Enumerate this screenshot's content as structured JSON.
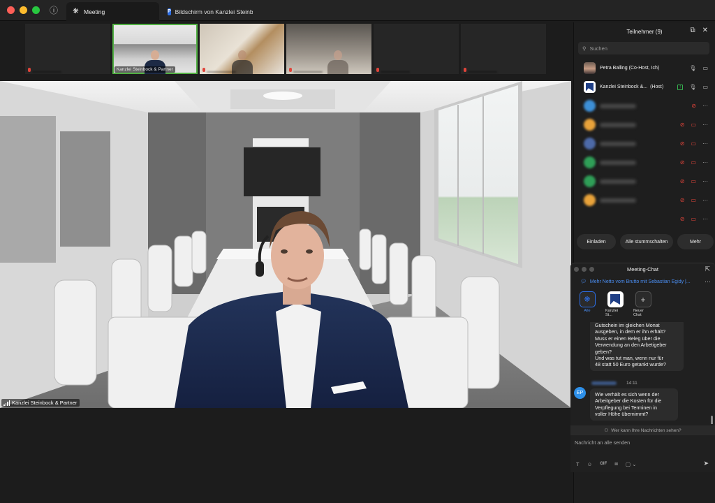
{
  "window": {
    "tab_active": "Meeting",
    "tab_share": "Bildschirm von Kanzlei Steinbock"
  },
  "gallery": {
    "selected_name": "Kanzlei Steinbock & Partner"
  },
  "speaker": {
    "name": "Kanzlei Steinbock & Partner"
  },
  "participants": {
    "title": "Teilnehmer (9)",
    "search_placeholder": "Suchen",
    "rows": [
      {
        "name": "Petra Balling (Co-Host, Ich)"
      },
      {
        "name": "Kanzlei Steinbock &...",
        "role": "(Host)"
      }
    ],
    "invite_label": "Einladen",
    "mute_all_label": "Alle stummschalten",
    "more_label": "Mehr"
  },
  "chat": {
    "title": "Meeting-Chat",
    "topic": "Mehr Netto vom Brutto mit Sebastian Egidy |...",
    "recipients": [
      {
        "label": "Alle"
      },
      {
        "label": "Kanzlei St..."
      },
      {
        "label": "Neuer Chat"
      }
    ],
    "message1": "Gutschein im gleichen Monat\nausgeben, in dem er ihn erhält?\nMuss er einen Beleg über die\nVerwendung an den Arbetigeber\ngeben?\nUnd was tut man, wenn nur für\n48 statt 50 Euro getankt wurde?",
    "sender_initials": "EP",
    "message2_time": "14:11",
    "message2": "Wie verhält es sich wenn der\nArbeitgeber die Kosten für die\nVerpflegung bei Terminen in\nvoller Höhe übernimmt?",
    "visibility": "Wer kann Ihre Nachrichten sehen?",
    "compose_placeholder": "Nachricht an alle senden",
    "gif_label": "GIF"
  },
  "colors": {
    "accent": "#2d6fe8",
    "selected_border": "#52b043",
    "muted_red": "#e0443a"
  }
}
